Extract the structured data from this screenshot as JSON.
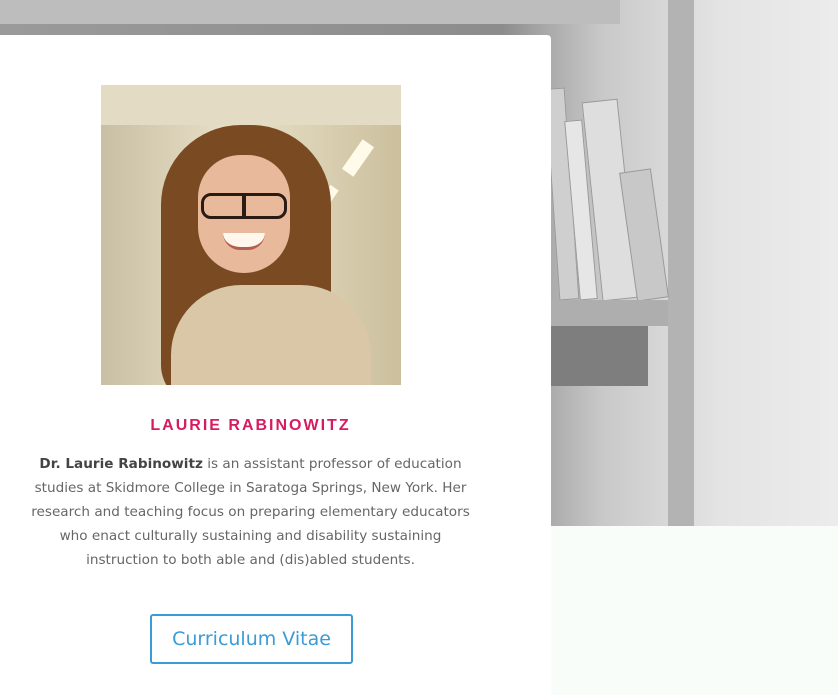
{
  "profile": {
    "name": "LAURIE RABINOWITZ",
    "bio_name": "Dr. Laurie Rabinowitz",
    "bio_text": " is an assistant professor of education studies at Skidmore College in Saratoga Springs, New York. Her research and teaching focus on preparing elementary educators who enact culturally sustaining and disability sustaining instruction to both able and (dis)abled students.",
    "cv_button_label": "Curriculum Vitae"
  },
  "colors": {
    "name_accent": "#d81b60",
    "button_accent": "#3a9bd5",
    "body_text": "#666666"
  }
}
